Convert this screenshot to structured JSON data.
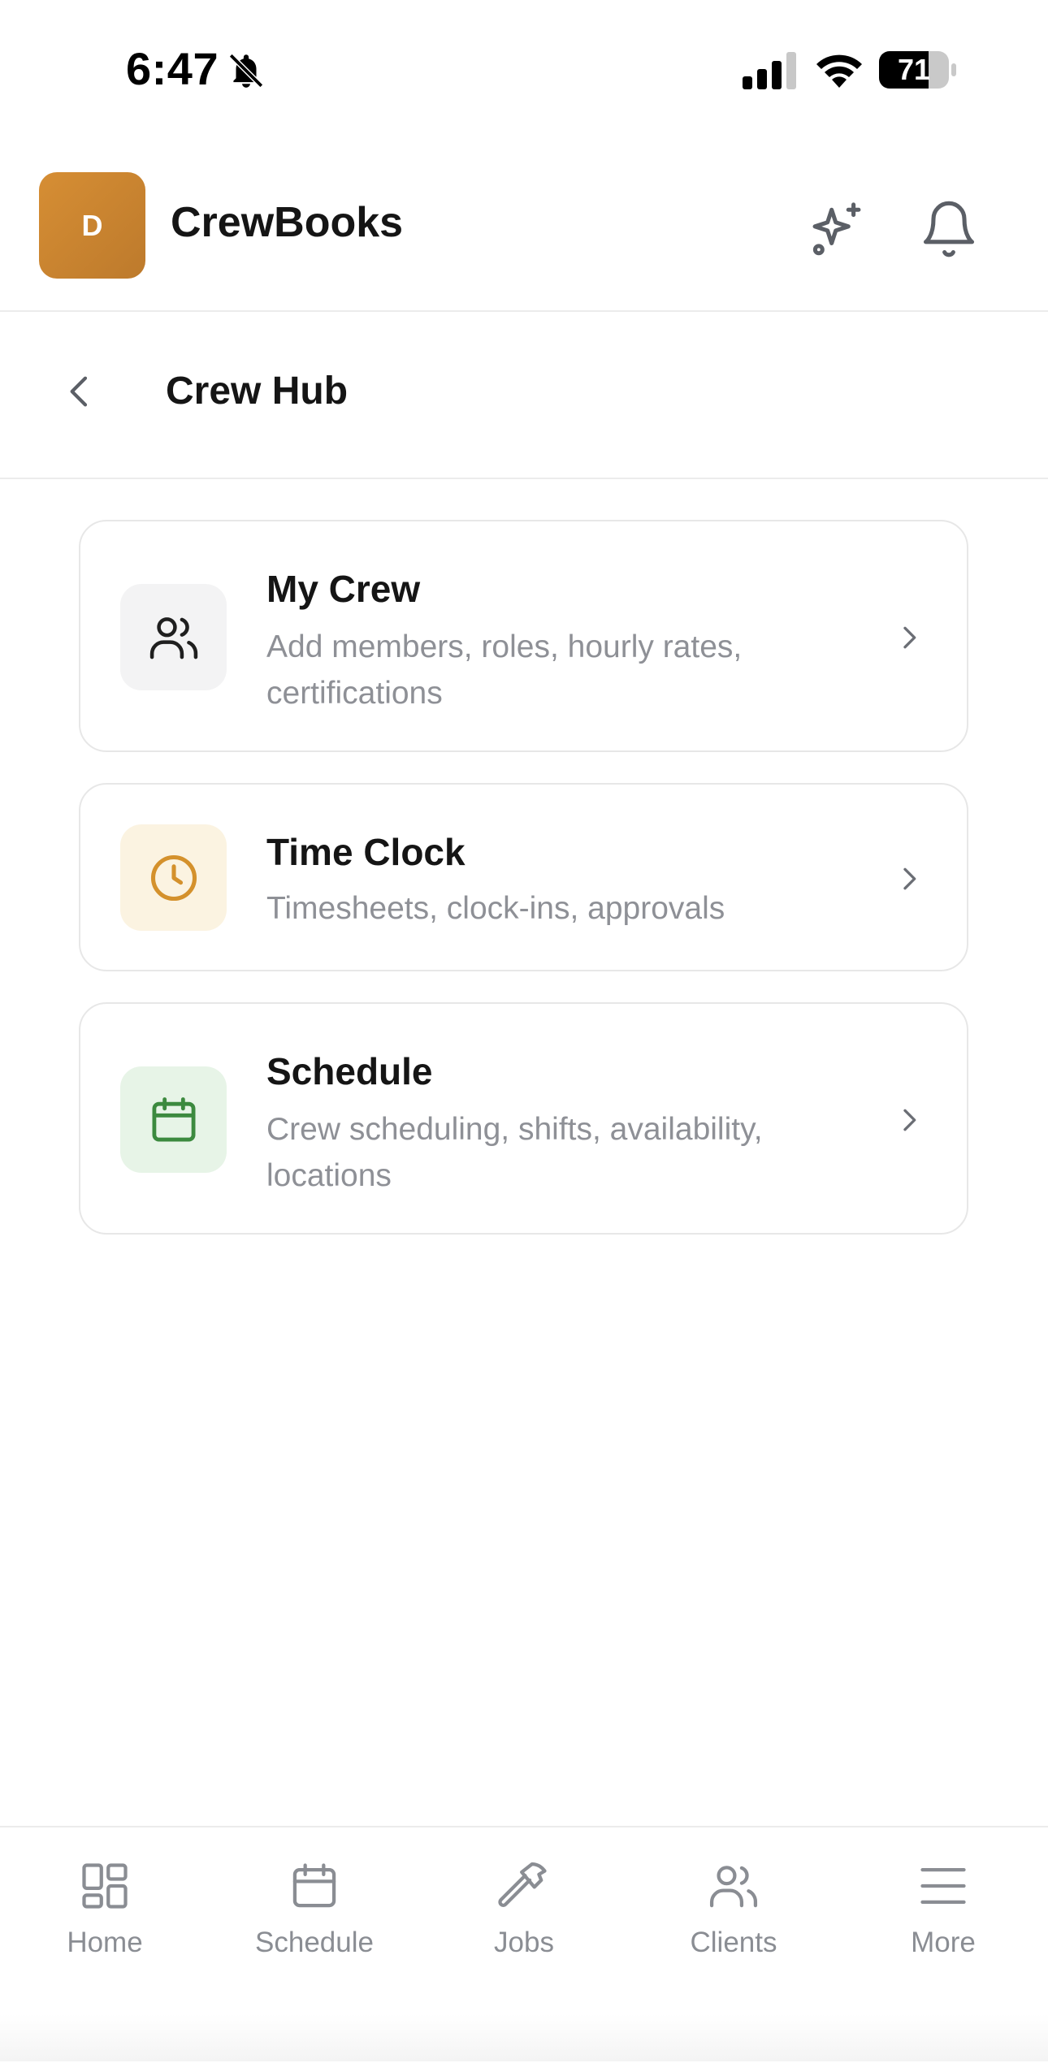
{
  "status_bar": {
    "time": "6:47",
    "battery": "71"
  },
  "header": {
    "logo_letter": "D",
    "app_name": "CrewBooks",
    "icons": [
      "sparkle-icon",
      "bell-icon"
    ]
  },
  "sub_header": {
    "title": "Crew Hub"
  },
  "cards": [
    {
      "title": "My Crew",
      "description": "Add members, roles, hourly rates, certifications",
      "icon": "users-icon",
      "icon_color": "#1f1f1f",
      "icon_bg": "#f3f3f4"
    },
    {
      "title": "Time Clock",
      "description": "Timesheets, clock-ins, approvals",
      "icon": "clock-icon",
      "icon_color": "#d4912c",
      "icon_bg": "#fbf3e1"
    },
    {
      "title": "Schedule",
      "description": "Crew scheduling, shifts, availability, locations",
      "icon": "calendar-icon",
      "icon_color": "#3c8a3f",
      "icon_bg": "#e7f4e7"
    }
  ],
  "bottom_nav": {
    "items": [
      {
        "label": "Home",
        "icon": "grid-icon"
      },
      {
        "label": "Schedule",
        "icon": "calendar-icon"
      },
      {
        "label": "Jobs",
        "icon": "hammer-icon"
      },
      {
        "label": "Clients",
        "icon": "users-icon"
      },
      {
        "label": "More",
        "icon": "menu-icon"
      }
    ]
  },
  "colors": {
    "brand": "#d68e34",
    "muted_text": "#8e9096",
    "nav_inactive": "#8a8d93"
  }
}
